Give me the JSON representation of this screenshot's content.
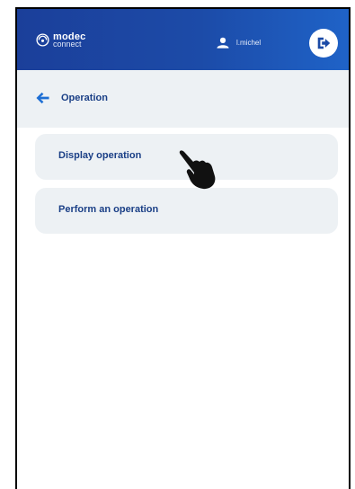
{
  "brand": {
    "name": "modec",
    "sub": "connect"
  },
  "user": {
    "name": "l.michel",
    "icon": "user-icon"
  },
  "header": {
    "logout_icon": "logout-icon"
  },
  "section": {
    "title": "Operation",
    "back_icon": "arrow-left-icon"
  },
  "menu": {
    "items": [
      {
        "label": "Display operation"
      },
      {
        "label": "Perform an operation"
      }
    ]
  },
  "colors": {
    "topbar_start": "#1b3f9a",
    "topbar_end": "#1f63c8",
    "accent": "#1a3f86",
    "arrow": "#1e6fd4",
    "panel": "#edf1f4"
  }
}
